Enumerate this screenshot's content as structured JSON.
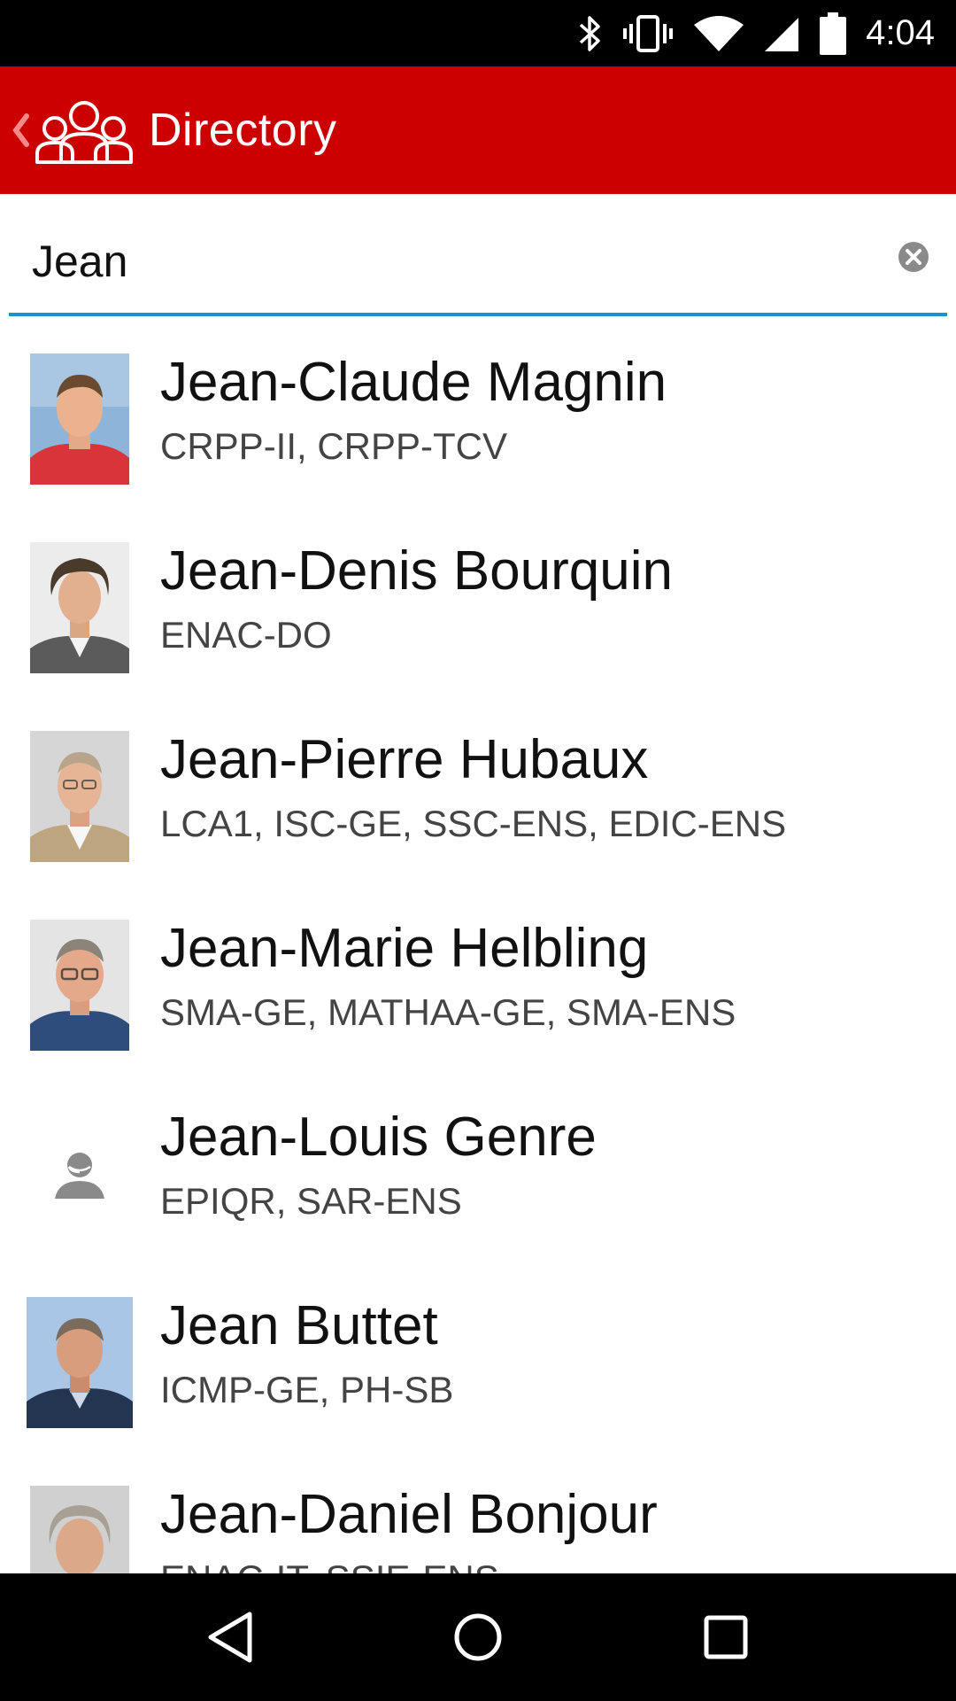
{
  "colors": {
    "app_bar": "#cc0000",
    "accent_underline": "#1e90c8",
    "status_bar": "#000000",
    "nav_bar": "#000000"
  },
  "status_bar": {
    "time": "4:04",
    "icons": [
      "bluetooth-icon",
      "vibrate-icon",
      "wifi-icon",
      "cell-signal-icon",
      "battery-icon"
    ]
  },
  "app_bar": {
    "title": "Directory",
    "logo_icon": "people-group-icon",
    "back_icon": "chevron-left-icon"
  },
  "search": {
    "value": "Jean",
    "clear_icon": "clear-circle-icon"
  },
  "results": [
    {
      "name": "Jean-Claude Magnin",
      "units": "CRPP-II, CRPP-TCV",
      "photo": "photo-red-shirt"
    },
    {
      "name": "Jean-Denis Bourquin",
      "units": "ENAC-DO",
      "photo": "photo-curly-hair"
    },
    {
      "name": "Jean-Pierre Hubaux",
      "units": "LCA1, ISC-GE, SSC-ENS, EDIC-ENS",
      "photo": "photo-glasses-beige"
    },
    {
      "name": "Jean-Marie Helbling",
      "units": "SMA-GE, MATHAA-GE, SMA-ENS",
      "photo": "photo-glasses-blue"
    },
    {
      "name": "Jean-Louis Genre",
      "units": "EPIQR, SAR-ENS",
      "photo": "default-avatar-icon"
    },
    {
      "name": "Jean Buttet",
      "units": "ICMP-GE, PH-SB",
      "photo": "photo-suit-blue"
    },
    {
      "name": "Jean-Daniel Bonjour",
      "units": "ENAC-IT, SSIE-ENS",
      "photo": "photo-gray-hair"
    }
  ],
  "nav_bar": {
    "back_icon": "nav-back-icon",
    "home_icon": "nav-home-icon",
    "recents_icon": "nav-recents-icon"
  }
}
